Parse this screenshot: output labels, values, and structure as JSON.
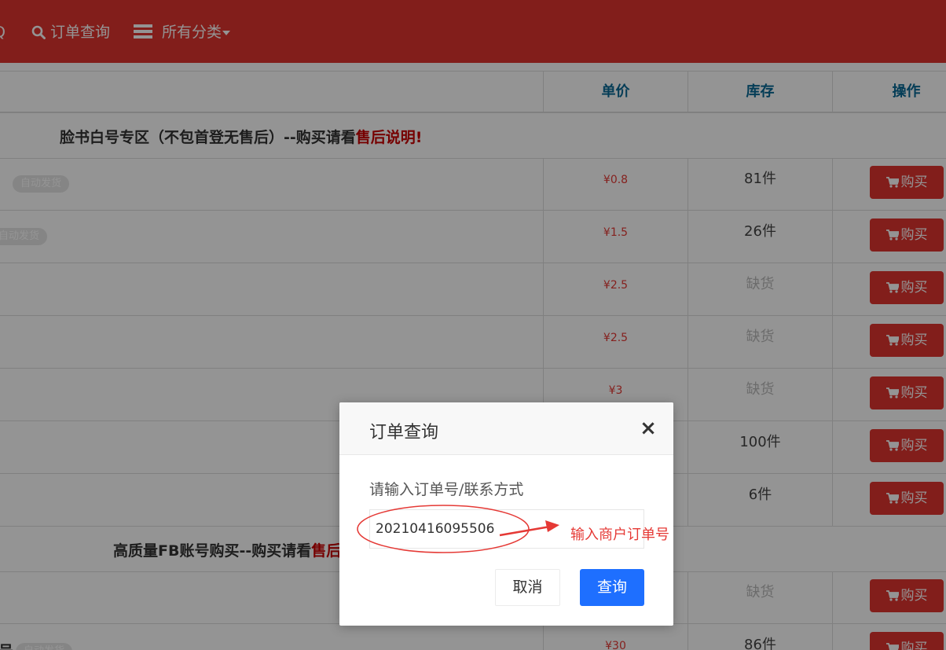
{
  "header": {
    "nav_partial": "Q",
    "nav_order_query": "订单查询",
    "nav_all_categories": "所有分类"
  },
  "table": {
    "columns": [
      "单价",
      "库存",
      "操作"
    ],
    "section1": {
      "title_prefix": "脸书白号专区（不包首登无售后）--购买请看",
      "title_red": "售后说明",
      "title_suffix": "!"
    },
    "section2": {
      "title_prefix": "高质量FB账号购买--购买请看",
      "title_red": "售后"
    },
    "auto_tag": "自动发货",
    "buy_label": "购买",
    "rows": [
      {
        "price": "¥0.8",
        "stock": "81件",
        "tag": "自动发货"
      },
      {
        "price": "¥1.5",
        "stock": "26件",
        "tag": "自动发货"
      },
      {
        "price": "¥2.5",
        "stock": "缺货"
      },
      {
        "price": "¥2.5",
        "stock": "缺货"
      },
      {
        "price": "¥3",
        "stock": "缺货"
      },
      {
        "price": "",
        "stock": "100件"
      },
      {
        "price": "",
        "stock": "6件"
      },
      {
        "price": "",
        "stock": "缺货"
      },
      {
        "price": "¥30",
        "stock": "86件",
        "tag": "自动发货",
        "name_partial": "号"
      }
    ]
  },
  "modal": {
    "title": "订单查询",
    "close": "×",
    "label": "请输入订单号/联系方式",
    "input_value": "20210416095506",
    "cancel_label": "取消",
    "query_label": "查询"
  },
  "annotation": {
    "text": "输入商户订单号",
    "color": "#e53935"
  },
  "colors": {
    "header": "#e0342f",
    "buy_button": "#e0342f",
    "query_button": "#1e6fff",
    "price": "#e53935"
  }
}
